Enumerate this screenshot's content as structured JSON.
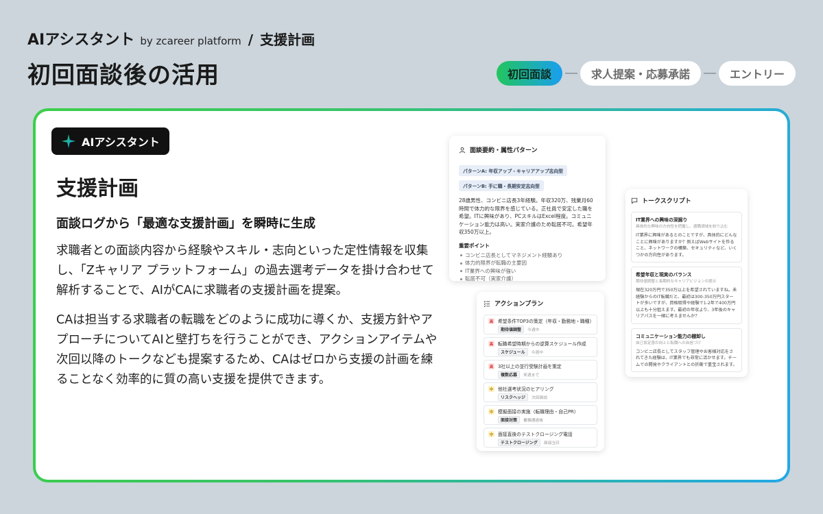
{
  "header": {
    "brand": "AIアシスタント",
    "by": "by zcareer platform",
    "separator": "/",
    "section": "支援計画",
    "page_title": "初回面談後の活用"
  },
  "stepper": {
    "steps": [
      "初回面談",
      "求人提案・応募承諾",
      "エントリー"
    ],
    "active_index": 0
  },
  "card": {
    "badge": "AIアシスタント",
    "title": "支援計画",
    "subtitle": "面談ログから「最適な支援計画」を瞬時に生成",
    "paragraph1": "求職者との面談内容から経験やスキル・志向といった定性情報を収集し、「Zキャリア プラットフォーム」の過去選考データを掛け合わせて解析することで、AIがCAに求職者の支援計画を提案。",
    "paragraph2": "CAは担当する求職者の転職をどのように成功に導くか、支援方針やアプローチについてAIと壁打ちを行うことができ、アクションアイテムや次回以降のトークなども提案するため、CAはゼロから支援の計画を練ることなく効率的に質の高い支援を提供できます。"
  },
  "summary_panel": {
    "title": "面談要約・属性パターン",
    "patterns": [
      "パターンA: 年収アップ・キャリアアップ志向型",
      "パターンB: 手に職・長期安定志向型"
    ],
    "text": "28歳男性、コンビニ店長3年経験。年収320万、残業月60時間で体力的な限界を感じている。正社員で安定した職を希望。ITに興味があり、PCスキルはExcel程度。コミュニケーション能力は高い。実家介護のため転居不可。希望年収350万以上。",
    "points_heading": "重要ポイント",
    "points": [
      "コンビニ店長としてマネジメント経験あり",
      "体力的限界が転職の主要因",
      "IT業界への興味が強い",
      "転居不可（実家介護）"
    ]
  },
  "action_panel": {
    "title": "アクションプラン",
    "items": [
      {
        "priority": "高",
        "level": "high",
        "text": "希望条件TOP3の策定（年収・勤務地・職種）",
        "tag": "期待値調整",
        "due": "今週中"
      },
      {
        "priority": "高",
        "level": "high",
        "text": "転職希望時期からの逆算スケジュール作成",
        "tag": "スケジュール",
        "due": "今週中"
      },
      {
        "priority": "高",
        "level": "high",
        "text": "3社以上の並行受験計画を策定",
        "tag": "複数応募",
        "due": "来週まで"
      },
      {
        "priority": "中",
        "level": "mid",
        "text": "他社選考状況のヒアリング",
        "tag": "リスクヘッジ",
        "due": "次回面談"
      },
      {
        "priority": "中",
        "level": "mid",
        "text": "模擬面接の実施（転職理由・自己PR）",
        "tag": "面接対策",
        "due": "書類通過後"
      },
      {
        "priority": "中",
        "level": "mid",
        "text": "面接直後のテストクロージング電話",
        "tag": "テストクロージング",
        "due": "面接当日"
      }
    ]
  },
  "talk_panel": {
    "title": "トークスクリプト",
    "items": [
      {
        "head": "IT業界への興味の深掘り",
        "sub": "具体的な興味の方向性を把握し、適職領域を絞り込む",
        "body": "IT業界に興味があるとのことですが、具体的にどんなことに興味がありますか？例えばWebサイトを作ること、ネットワークの構築、セキュリティなど、いくつかの方向性があります。"
      },
      {
        "head": "希望年収と現実のバランス",
        "sub": "期待値調整と長期的なキャリアビジョンの提示",
        "body": "現在320万円で350万以上を希望されていますね。未経験からのIT転職だと、最初は300-350万円スタートが多いですが、資格取得や経験で1-2年で400万円以上も十分狙えます。最初の年収より、3年後のキャリアパスを一緒に考えませんか？"
      },
      {
        "head": "コミュニケーション能力の棚卸し",
        "sub": "自己肯定感の向上と転職への自信づけ",
        "body": "コンビニ店長としてスタッフ管理やお客様対応をされてきた経験は、IT業界でも非常に活かせます。チームでの開発やクライアントとの折衝で重宝されます。"
      }
    ]
  },
  "colors": {
    "background": "#ccd5dc",
    "accent_green": "#22c55e",
    "accent_blue": "#1a9ef0",
    "badge_bg": "#111111"
  }
}
